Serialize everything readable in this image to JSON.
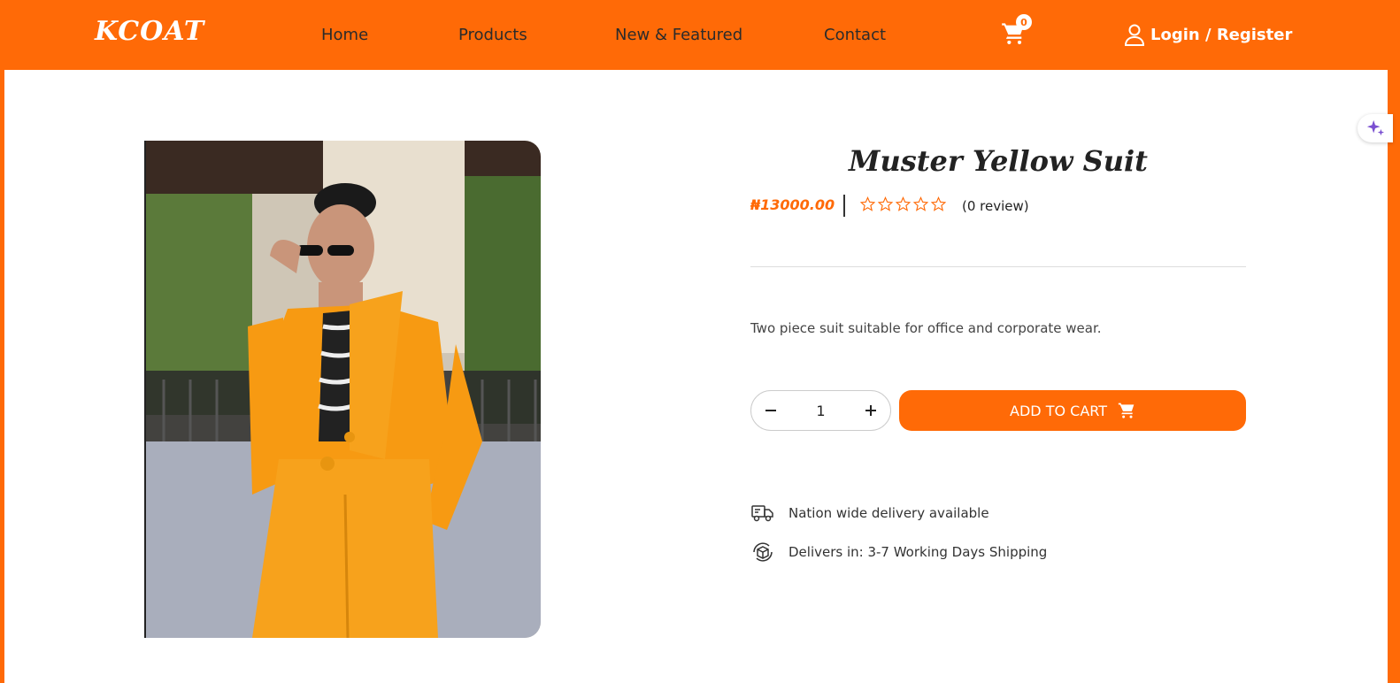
{
  "brand": {
    "logo": "KCOAT",
    "accent_color": "#ff6a07"
  },
  "nav": {
    "items": [
      {
        "label": "Home"
      },
      {
        "label": "Products"
      },
      {
        "label": "New & Featured"
      },
      {
        "label": "Contact"
      }
    ],
    "cart_count": "0",
    "login_label": "Login / Register"
  },
  "product": {
    "title": "Muster Yellow Suit",
    "price": "₦13000.00",
    "rating": 0,
    "max_rating": 5,
    "review_text": "(0 review)",
    "description": "Two piece suit suitable for office and corporate wear.",
    "quantity": "1",
    "add_to_cart_label": "ADD TO CART"
  },
  "features": [
    {
      "icon": "delivery-truck-icon",
      "text": "Nation wide delivery available"
    },
    {
      "icon": "package-shipping-icon",
      "text": "Delivers in: 3-7 Working Days Shipping"
    }
  ]
}
